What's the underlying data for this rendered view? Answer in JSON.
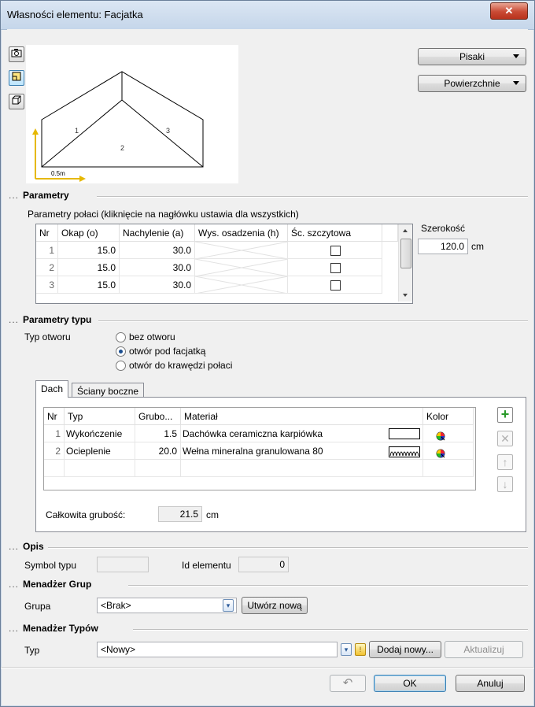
{
  "window": {
    "title": "Własności elementu: Facjatka",
    "close_icon": "close-icon"
  },
  "preview": {
    "face_labels": [
      "1",
      "2",
      "3"
    ],
    "scale_label": "0.5m",
    "tools": [
      "camera-icon",
      "2d-view-icon",
      "3d-view-icon"
    ]
  },
  "dropdowns": {
    "pens_label": "Pisaki",
    "surfaces_label": "Powierzchnie"
  },
  "parametry": {
    "section_title": "Parametry",
    "grid_caption": "Parametry połaci (kliknięcie na nagłówku ustawia dla wszystkich)",
    "columns": [
      "Nr",
      "Okap (o)",
      "Nachylenie (a)",
      "Wys. osadzenia (h)",
      "Śc. szczytowa"
    ],
    "rows": [
      {
        "nr": "1",
        "okap": "15.0",
        "nachylenie": "30.0",
        "wys": "",
        "sciana": false
      },
      {
        "nr": "2",
        "okap": "15.0",
        "nachylenie": "30.0",
        "wys": "",
        "sciana": false
      },
      {
        "nr": "3",
        "okap": "15.0",
        "nachylenie": "30.0",
        "wys": "",
        "sciana": false
      }
    ],
    "width_label": "Szerokość",
    "width_value": "120.0",
    "width_unit": "cm"
  },
  "parametry_typu": {
    "section_title": "Parametry typu",
    "opening_label": "Typ otworu",
    "options": [
      "bez otworu",
      "otwór pod facjatką",
      "otwór do krawędzi połaci"
    ],
    "selected": "otwór pod facjatką",
    "tabs": [
      "Dach",
      "Ściany boczne"
    ],
    "active_tab": "Dach",
    "layer_columns": [
      "Nr",
      "Typ",
      "Grubo...",
      "Materiał",
      "Kolor"
    ],
    "layers": [
      {
        "nr": "1",
        "typ": "Wykończenie",
        "grubosc": "1.5",
        "material": "Dachówka ceramiczna karpiówka",
        "pattern": "solid"
      },
      {
        "nr": "2",
        "typ": "Ocieplenie",
        "grubosc": "20.0",
        "material": "Wełna mineralna granulowana 80",
        "pattern": "insulation"
      }
    ],
    "total_label": "Całkowita grubość:",
    "total_value": "21.5",
    "total_unit": "cm",
    "side_buttons": [
      "add-icon",
      "delete-icon",
      "move-up-icon",
      "move-down-icon"
    ]
  },
  "opis": {
    "section_title": "Opis",
    "symbol_label": "Symbol typu",
    "symbol_value": "",
    "id_label": "Id elementu",
    "id_value": "0"
  },
  "grupy": {
    "section_title": "Menadżer Grup",
    "group_label": "Grupa",
    "group_value": "<Brak>",
    "create_button": "Utwórz nową"
  },
  "typy": {
    "section_title": "Menadżer Typów",
    "type_label": "Typ",
    "type_value": "<Nowy>",
    "add_button": "Dodaj nowy...",
    "update_button": "Aktualizuj"
  },
  "footer": {
    "ok": "OK",
    "cancel": "Anuluj"
  }
}
